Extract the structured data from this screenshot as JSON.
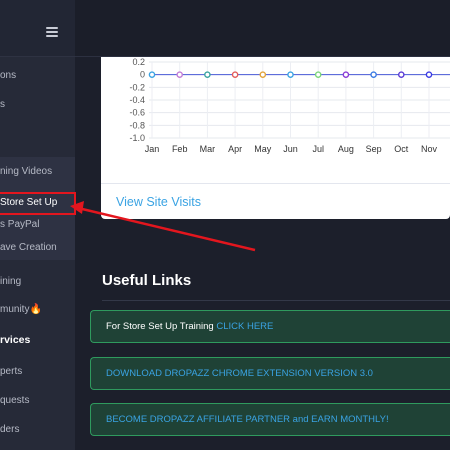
{
  "sidebar": {
    "items": [
      {
        "label": "ons"
      },
      {
        "label": "s"
      },
      {
        "label": "ning Videos"
      },
      {
        "label": "Store Set Up"
      },
      {
        "label": "s PayPal"
      },
      {
        "label": "ave Creation"
      },
      {
        "label": "ining"
      },
      {
        "label": "munity🔥"
      },
      {
        "label": "rvices"
      },
      {
        "label": "perts"
      },
      {
        "label": "quests"
      },
      {
        "label": "ders"
      }
    ]
  },
  "chart_data": {
    "type": "line",
    "categories": [
      "Jan",
      "Feb",
      "Mar",
      "Apr",
      "May",
      "Jun",
      "Jul",
      "Aug",
      "Sep",
      "Oct",
      "Nov",
      "D"
    ],
    "y_ticks": [
      "0.2",
      "0",
      "-0.2",
      "-0.4",
      "-0.6",
      "-0.8",
      "-1.0"
    ],
    "ylim": [
      -1.0,
      0.2
    ],
    "series": [
      {
        "values": [
          0,
          0,
          0,
          0,
          0,
          0,
          0,
          0,
          0,
          0,
          0,
          0
        ],
        "color": "#4a5bd8"
      }
    ],
    "point_colors": [
      "#3aa3e3",
      "#c17bd6",
      "#3aa3a0",
      "#e35b5b",
      "#e3a33a",
      "#3aa3e3",
      "#7bd67b",
      "#8a3ad6",
      "#3a7ae3",
      "#5a3ad6",
      "#3a3ae3",
      "#3aa3e3"
    ],
    "grid": true
  },
  "card": {
    "footer_link": "View Site Visits"
  },
  "links": {
    "title": "Useful Links",
    "items": [
      {
        "plain": "For Store Set Up Training ",
        "link": "CLICK HERE"
      },
      {
        "plain": "",
        "link": "DOWNLOAD DROPAZZ CHROME EXTENSION VERSION 3.0"
      },
      {
        "plain": "",
        "link": "BECOME DROPAZZ AFFILIATE PARTNER and EARN MONTHLY!"
      }
    ]
  },
  "colors": {
    "accent": "#3aa3e3",
    "highlight": "#e3161e",
    "link_border": "#2f9a5e"
  }
}
